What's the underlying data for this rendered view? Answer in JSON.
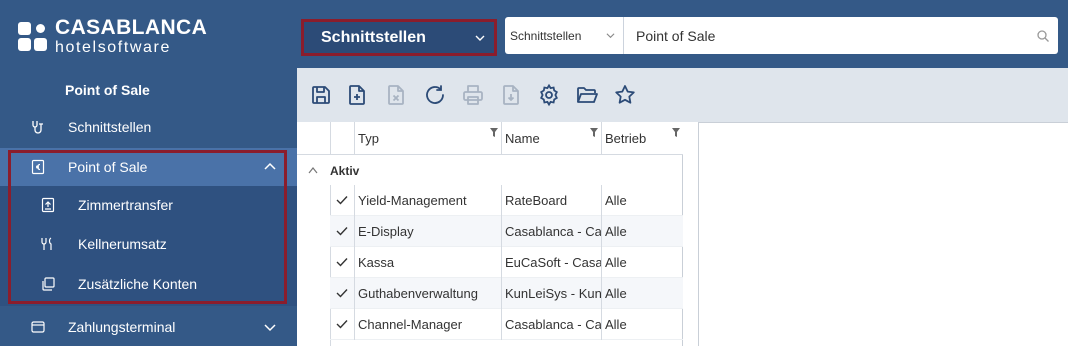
{
  "logo": {
    "main": "CASABLANCA",
    "sub": "hotelsoftware"
  },
  "sidebar": {
    "section_title": "Point of Sale",
    "items": [
      {
        "label": "Schnittstellen",
        "icon": "plug-icon"
      },
      {
        "label": "Point of Sale",
        "icon": "euro-icon",
        "expanded": true
      },
      {
        "label": "Zimmertransfer",
        "icon": "upload-icon"
      },
      {
        "label": "Kellnerumsatz",
        "icon": "cutlery-icon"
      },
      {
        "label": "Zusätzliche Konten",
        "icon": "copy-icon"
      },
      {
        "label": "Zahlungsterminal",
        "icon": "terminal-icon"
      }
    ]
  },
  "topbar": {
    "module_select": "Schnittstellen",
    "search_scope": "Schnittstellen",
    "search_query": "Point of Sale"
  },
  "toolbar": {
    "buttons": [
      "save-icon",
      "new-icon",
      "delete-icon",
      "refresh-icon",
      "print-icon",
      "export-icon",
      "settings-icon",
      "open-folder-icon",
      "favorite-icon"
    ]
  },
  "grid": {
    "columns": [
      "Typ",
      "Name",
      "Betrieb"
    ],
    "group_label": "Aktiv",
    "rows": [
      {
        "typ": "Yield-Management",
        "name": "RateBoard",
        "betrieb": "Alle"
      },
      {
        "typ": "E-Display",
        "name": "Casablanca - Ca",
        "betrieb": "Alle"
      },
      {
        "typ": "Kassa",
        "name": "EuCaSoft - Casal",
        "betrieb": "Alle"
      },
      {
        "typ": "Guthabenverwaltung",
        "name": "KunLeiSys - KunL",
        "betrieb": "Alle"
      },
      {
        "typ": "Channel-Manager",
        "name": "Casablanca - Ca",
        "betrieb": "Alle"
      }
    ]
  },
  "colors": {
    "sidebar_bg": "#345987",
    "active_item": "#4a72a8",
    "highlight": "#8b1d2c",
    "toolbar_bg": "#dfe5ec"
  }
}
